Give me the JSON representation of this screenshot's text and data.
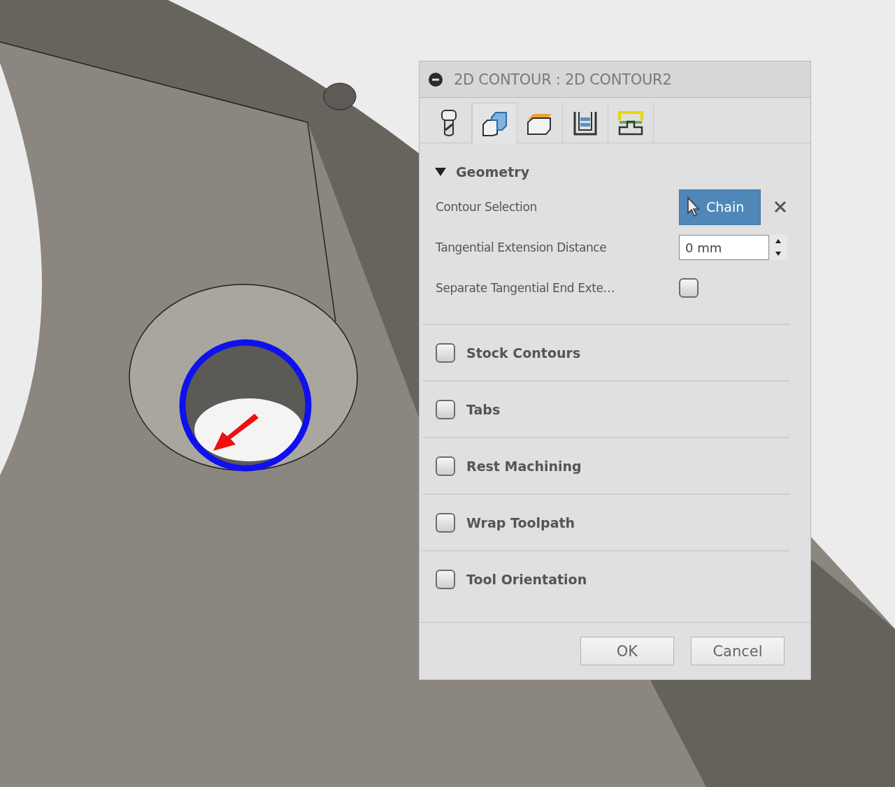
{
  "dialog": {
    "title": "2D CONTOUR : 2D CONTOUR2",
    "tabs": [
      {
        "kind": "tool",
        "selected": false
      },
      {
        "kind": "geometry",
        "selected": true
      },
      {
        "kind": "heights",
        "selected": false
      },
      {
        "kind": "passes",
        "selected": false
      },
      {
        "kind": "linking",
        "selected": false
      }
    ],
    "section": {
      "title": "Geometry",
      "expanded": true,
      "fields": [
        {
          "kind": "selection",
          "label": "Contour Selection",
          "button": "Chain"
        },
        {
          "kind": "number",
          "label": "Tangential Extension Distance",
          "value": "0 mm"
        },
        {
          "kind": "checkbox",
          "label": "Separate Tangential End Exte…",
          "checked": false
        }
      ]
    },
    "groups": [
      {
        "label": "Stock Contours",
        "checked": false
      },
      {
        "label": "Tabs",
        "checked": false
      },
      {
        "label": "Rest Machining",
        "checked": false
      },
      {
        "label": "Wrap Toolpath",
        "checked": false
      },
      {
        "label": "Tool Orientation",
        "checked": false
      }
    ],
    "buttons": [
      "OK",
      "Cancel"
    ]
  }
}
